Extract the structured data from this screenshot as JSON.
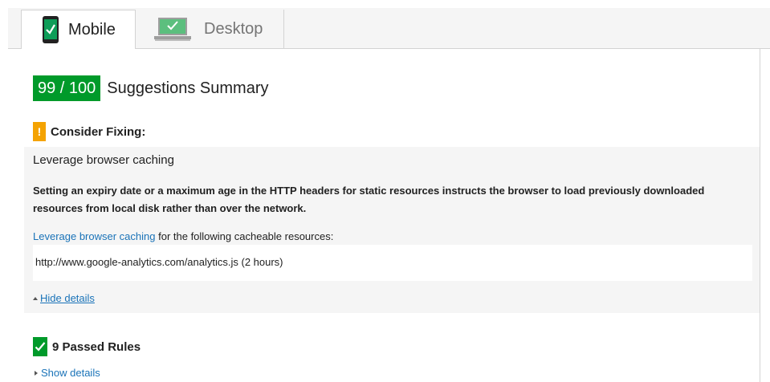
{
  "tabs": [
    {
      "label": "Mobile",
      "icon": "mobile-phone-icon",
      "active": true
    },
    {
      "label": "Desktop",
      "icon": "desktop-monitor-icon",
      "active": false
    }
  ],
  "summary": {
    "score": "99 / 100",
    "title": "Suggestions Summary",
    "score_color": "#009a2a"
  },
  "consider_fixing": {
    "heading": "Consider Fixing:",
    "icon": "warning-icon",
    "icon_glyph": "!",
    "icon_color": "#f4a302"
  },
  "rule": {
    "title": "Leverage browser caching",
    "description": "Setting an expiry date or a maximum age in the HTTP headers for static resources instructs the browser to load previously downloaded resources from local disk rather than over the network.",
    "link_text": "Leverage browser caching",
    "link_suffix": " for the following cacheable resources:",
    "resources": [
      "http://www.google-analytics.com/analytics.js (2 hours)"
    ],
    "toggle_label": "Hide details"
  },
  "passed": {
    "heading": "9 Passed Rules",
    "icon": "checkmark-icon",
    "toggle_label": "Show details"
  }
}
